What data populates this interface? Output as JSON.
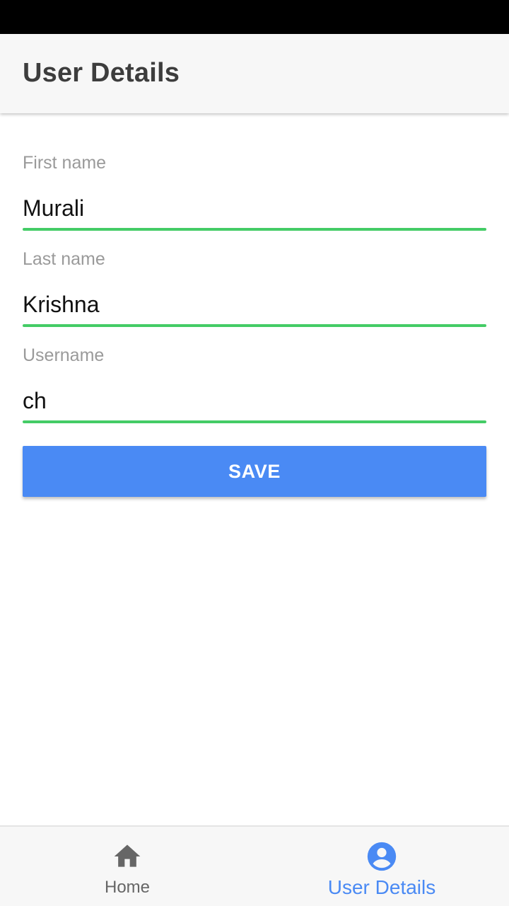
{
  "app_bar": {
    "title": "User Details"
  },
  "form": {
    "first_name": {
      "label": "First name",
      "value": "Murali"
    },
    "last_name": {
      "label": "Last name",
      "value": "Krishna"
    },
    "username": {
      "label": "Username",
      "value": "ch"
    },
    "save_label": "SAVE"
  },
  "tabs": [
    {
      "label": "Home",
      "icon": "home-icon",
      "active": false
    },
    {
      "label": "User Details",
      "icon": "account-circle-icon",
      "active": true
    }
  ],
  "colors": {
    "accent": "#4a8af4",
    "field_underline": "#44cc66",
    "active_tab": "#4a8af4",
    "inactive_tab": "#666666"
  }
}
